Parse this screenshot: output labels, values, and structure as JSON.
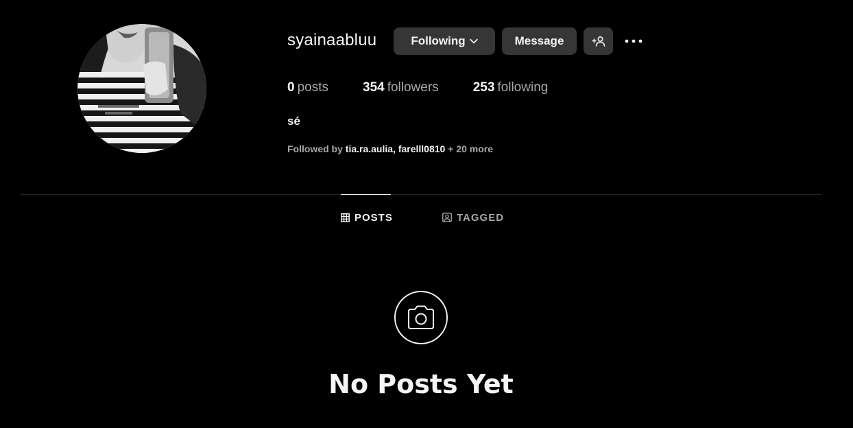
{
  "profile": {
    "username": "syainaabluu",
    "display_name": "sé",
    "avatar_icon": "profile-photo"
  },
  "actions": {
    "following_label": "Following",
    "message_label": "Message",
    "add_user_icon": "add-user-icon",
    "more_icon": "more-options-icon"
  },
  "stats": {
    "posts_count": "0",
    "posts_label": "posts",
    "followers_count": "354",
    "followers_label": "followers",
    "following_count": "253",
    "following_label": "following"
  },
  "followed_by": {
    "prefix": "Followed by",
    "user1": "tia.ra.aulia",
    "separator": ",",
    "user2": "farelll0810",
    "more": "+ 20 more"
  },
  "tabs": [
    {
      "label": "POSTS",
      "icon": "grid-icon",
      "active": true
    },
    {
      "label": "TAGGED",
      "icon": "tagged-icon",
      "active": false
    }
  ],
  "empty_state": {
    "icon": "camera-icon",
    "title": "No Posts Yet"
  },
  "colors": {
    "background": "#000000",
    "button": "#363636",
    "text_primary": "#f5f5f5",
    "text_secondary": "#a8a8a8",
    "divider": "#262626"
  }
}
